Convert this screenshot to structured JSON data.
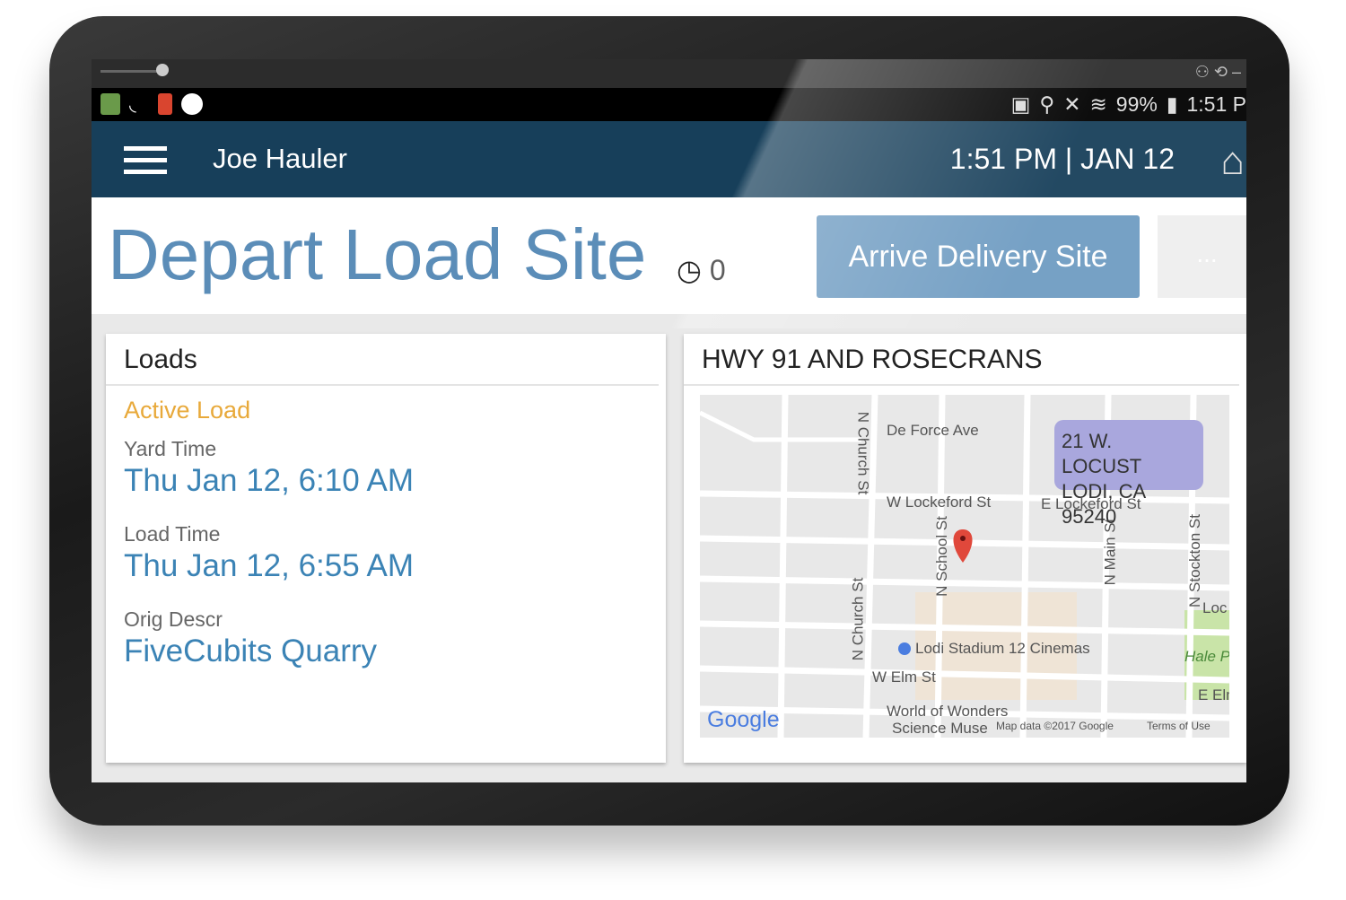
{
  "status_bar": {
    "battery": "99%",
    "time": "1:51 P"
  },
  "header": {
    "user": "Joe Hauler",
    "datetime": "1:51 PM | JAN 12"
  },
  "page": {
    "title": "Depart Load Site",
    "timer_count": "0",
    "arrive_button": "Arrive Delivery Site",
    "more_button": "..."
  },
  "loads": {
    "heading": "Loads",
    "active_label": "Active Load",
    "fields": [
      {
        "label": "Yard Time",
        "value": "Thu Jan 12, 6:10 AM"
      },
      {
        "label": "Load Time",
        "value": "Thu Jan 12, 6:55 AM"
      },
      {
        "label": "Orig Descr",
        "value": "FiveCubits Quarry"
      }
    ]
  },
  "map": {
    "heading": "HWY 91 AND ROSECRANS",
    "address_line1": "21 W. LOCUST",
    "address_line2": "LODI, CA 95240",
    "labels": {
      "deforce": "De Force Ave",
      "wlockeford": "W Lockeford St",
      "elockeford": "E Lockeford St",
      "nchurch": "N Church St",
      "nchurch2": "N Church St",
      "nschool": "N School St",
      "nmain": "N Main St",
      "nstockton": "N Stockton St",
      "cinema": "Lodi Stadium 12 Cinemas",
      "welm": "W Elm St",
      "wonders1": "World of Wonders",
      "wonders2": "Science Muse",
      "hale": "Hale P",
      "eelm": "E Elm",
      "loc": "Loc"
    },
    "google": "Google",
    "attribution": "Map data ©2017 Google",
    "terms": "Terms of Use"
  },
  "colors": {
    "header": "#173f5a",
    "title": "#5b8db8",
    "accent": "#e8a93a",
    "value": "#3b83b5",
    "button": "#6f9cc2"
  }
}
